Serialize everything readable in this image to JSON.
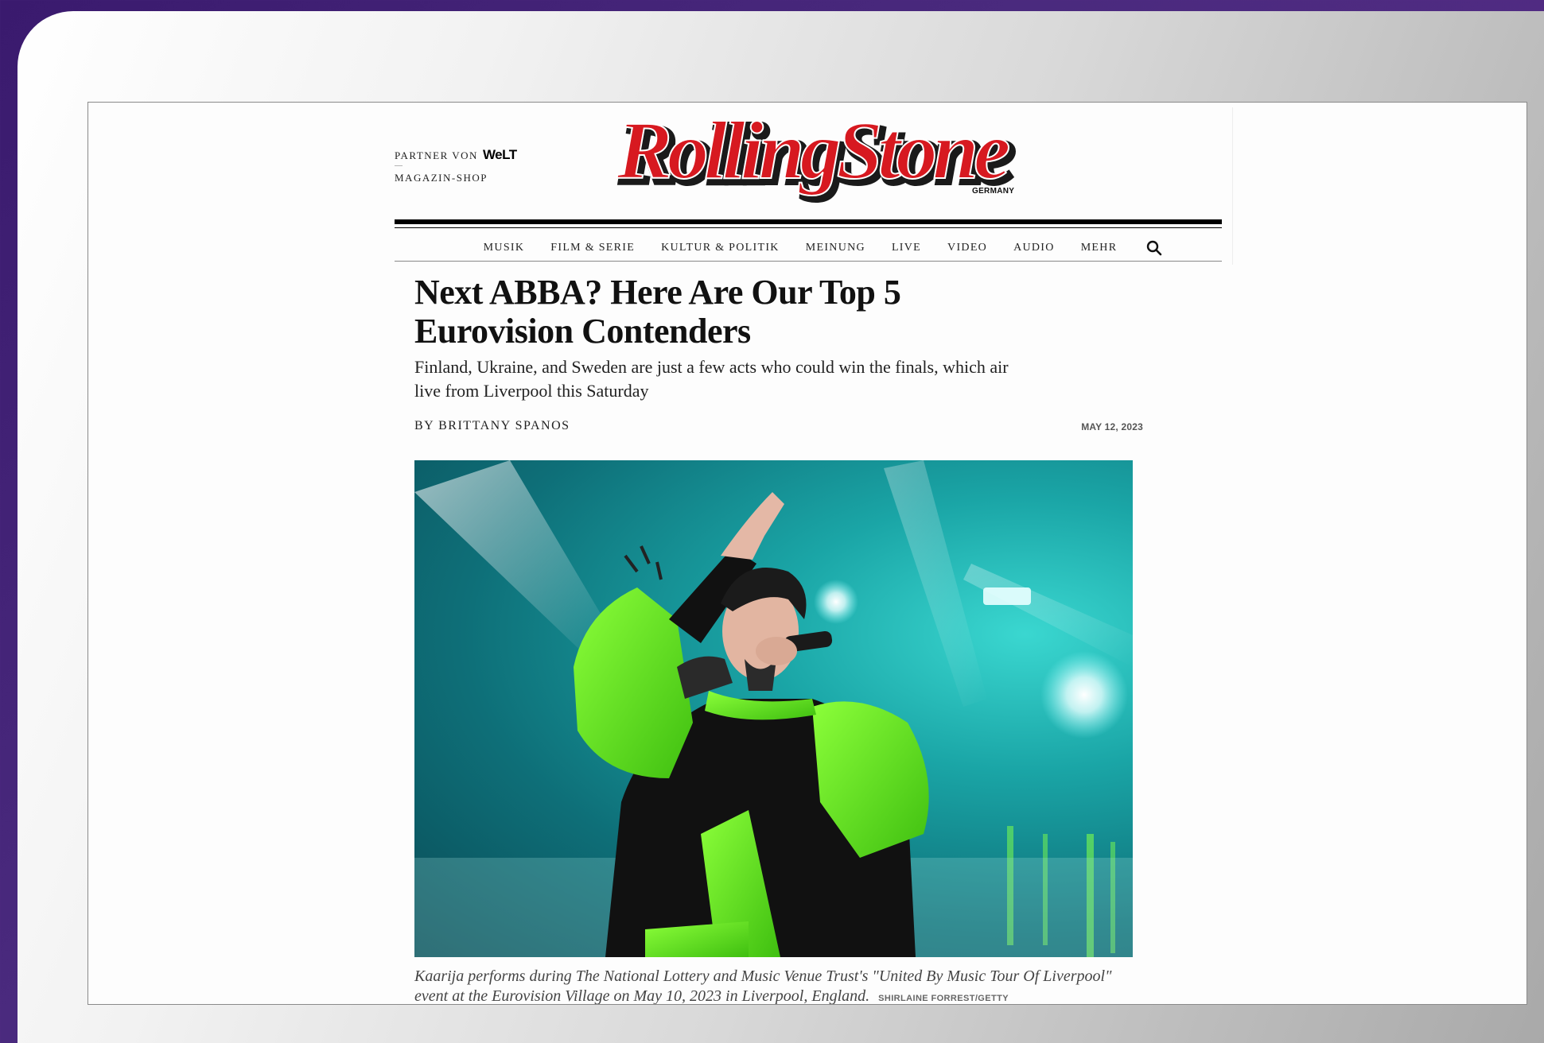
{
  "masthead": {
    "partner_label": "PARTNER VON",
    "partner_brand": "WeLT",
    "separator": "—",
    "shop_label": "MAGAZIN-SHOP",
    "logo_text": "RollingStone",
    "edition": "GERMANY"
  },
  "nav": {
    "items": [
      "MUSIK",
      "FILM & SERIE",
      "KULTUR & POLITIK",
      "MEINUNG",
      "LIVE",
      "VIDEO",
      "AUDIO",
      "MEHR"
    ],
    "search_icon": "search-icon"
  },
  "article": {
    "headline": "Next ABBA? Here Are Our Top 5 Eurovision Contenders",
    "dek": "Finland, Ukraine, and Sweden are just a few acts who could win the finals, which air live from Liverpool this Saturday",
    "byline": "BY BRITTANY SPANOS",
    "date": "MAY 12, 2023",
    "caption": "Kaarija performs during The National Lottery and Music Venue Trust's \"United By Music Tour Of Liverpool\" event at the Eurovision Village on May 10, 2023 in Liverpool, England.",
    "credit": "SHIRLAINE FORREST/GETTY"
  },
  "colors": {
    "logo_red": "#d71920",
    "logo_shadow": "#1a1a1a",
    "outfit_green": "#62e020",
    "stage_teal": "#1aa5a6"
  }
}
